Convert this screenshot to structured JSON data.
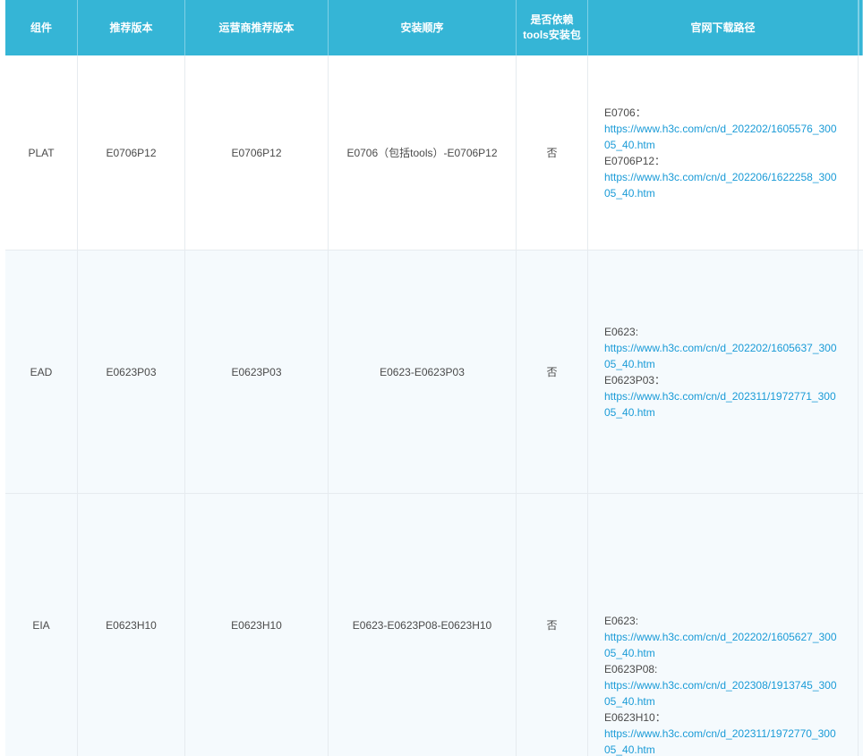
{
  "colors": {
    "header_bg": "#35b5d6",
    "link": "#1a9bd7",
    "row_alt_bg": "#f5fafd"
  },
  "headers": [
    "组件",
    "推荐版本",
    "运营商推荐版本",
    "安装顺序",
    "是否依赖tools安装包",
    "官网下载路径"
  ],
  "rows": [
    {
      "component": "PLAT",
      "recommended": "E0706P12",
      "carrier_recommended": "E0706P12",
      "install_order": "E0706（包括tools）-E0706P12",
      "depends_tools": "否",
      "downloads": [
        {
          "version": "E0706：",
          "url": "https://www.h3c.com/cn/d_202202/1605576_30005_40.htm"
        },
        {
          "version": "E0706P12：",
          "url": "https://www.h3c.com/cn/d_202206/1622258_30005_40.htm"
        }
      ]
    },
    {
      "component": "EAD",
      "recommended": "E0623P03",
      "carrier_recommended": "E0623P03",
      "install_order": "E0623-E0623P03",
      "depends_tools": "否",
      "downloads": [
        {
          "version": "E0623:",
          "url": "https://www.h3c.com/cn/d_202202/1605637_30005_40.htm"
        },
        {
          "version": "E0623P03：",
          "url": "https://www.h3c.com/cn/d_202311/1972771_30005_40.htm"
        }
      ]
    },
    {
      "component": "EIA",
      "recommended": "E0623H10",
      "carrier_recommended": "E0623H10",
      "install_order": "E0623-E0623P08-E0623H10",
      "depends_tools": "否",
      "downloads": [
        {
          "version": "E0623:",
          "url": "https://www.h3c.com/cn/d_202202/1605627_30005_40.htm"
        },
        {
          "version": "E0623P08:",
          "url": "https://www.h3c.com/cn/d_202308/1913745_30005_40.htm"
        },
        {
          "version": "E0623H10：",
          "url": "https://www.h3c.com/cn/d_202311/1972770_30005_40.htm"
        }
      ]
    }
  ]
}
